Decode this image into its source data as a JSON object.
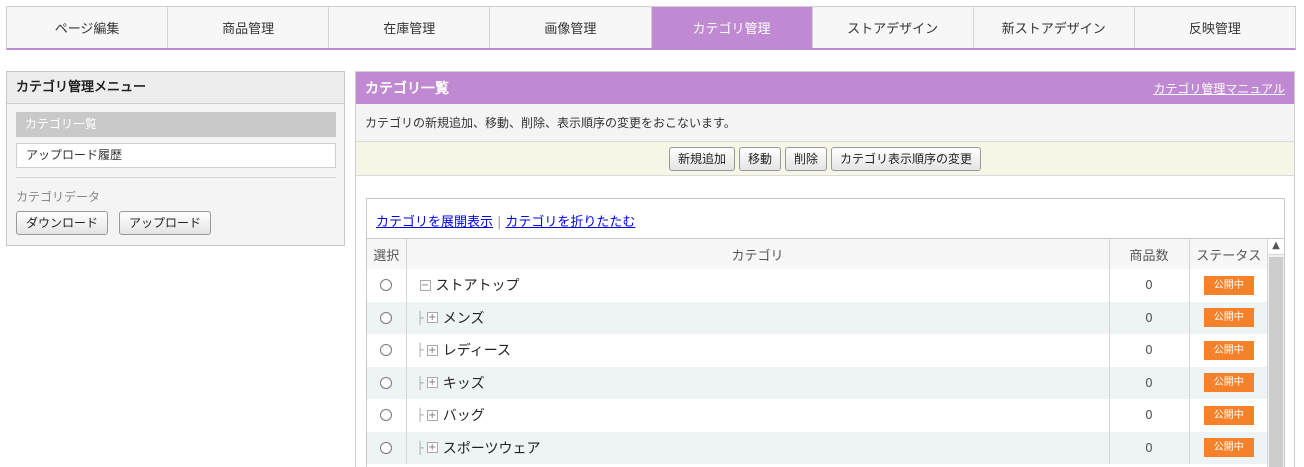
{
  "nav": {
    "tabs": [
      {
        "label": "ページ編集"
      },
      {
        "label": "商品管理"
      },
      {
        "label": "在庫管理"
      },
      {
        "label": "画像管理"
      },
      {
        "label": "カテゴリ管理"
      },
      {
        "label": "ストアデザイン"
      },
      {
        "label": "新ストアデザイン"
      },
      {
        "label": "反映管理"
      }
    ],
    "active_index": 4
  },
  "sidebar": {
    "title": "カテゴリ管理メニュー",
    "items": [
      {
        "label": "カテゴリ一覧"
      },
      {
        "label": "アップロード履歴"
      }
    ],
    "data_section_label": "カテゴリデータ",
    "download_label": "ダウンロード",
    "upload_label": "アップロード"
  },
  "main": {
    "title": "カテゴリ一覧",
    "manual_link": "カテゴリ管理マニュアル",
    "description": "カテゴリの新規追加、移動、削除、表示順序の変更をおこないます。",
    "actions": {
      "add": "新規追加",
      "move": "移動",
      "delete": "削除",
      "reorder": "カテゴリ表示順序の変更"
    },
    "expand_all": "カテゴリを展開表示",
    "link_separator": "|",
    "collapse_all": "カテゴリを折りたたむ",
    "table": {
      "headers": {
        "select": "選択",
        "category": "カテゴリ",
        "count": "商品数",
        "status": "ステータス"
      },
      "rows": [
        {
          "name": "ストアトップ",
          "count": "0",
          "status": "公開中",
          "expander": "−",
          "branch": ""
        },
        {
          "name": "メンズ",
          "count": "0",
          "status": "公開中",
          "expander": "+",
          "branch": "├"
        },
        {
          "name": "レディース",
          "count": "0",
          "status": "公開中",
          "expander": "+",
          "branch": "├"
        },
        {
          "name": "キッズ",
          "count": "0",
          "status": "公開中",
          "expander": "+",
          "branch": "├"
        },
        {
          "name": "バッグ",
          "count": "0",
          "status": "公開中",
          "expander": "+",
          "branch": "├"
        },
        {
          "name": "スポーツウェア",
          "count": "0",
          "status": "公開中",
          "expander": "+",
          "branch": "├"
        }
      ]
    }
  },
  "colors": {
    "accent": "#c08ad3",
    "status_badge": "#f5812a",
    "link": "#0000ee"
  }
}
